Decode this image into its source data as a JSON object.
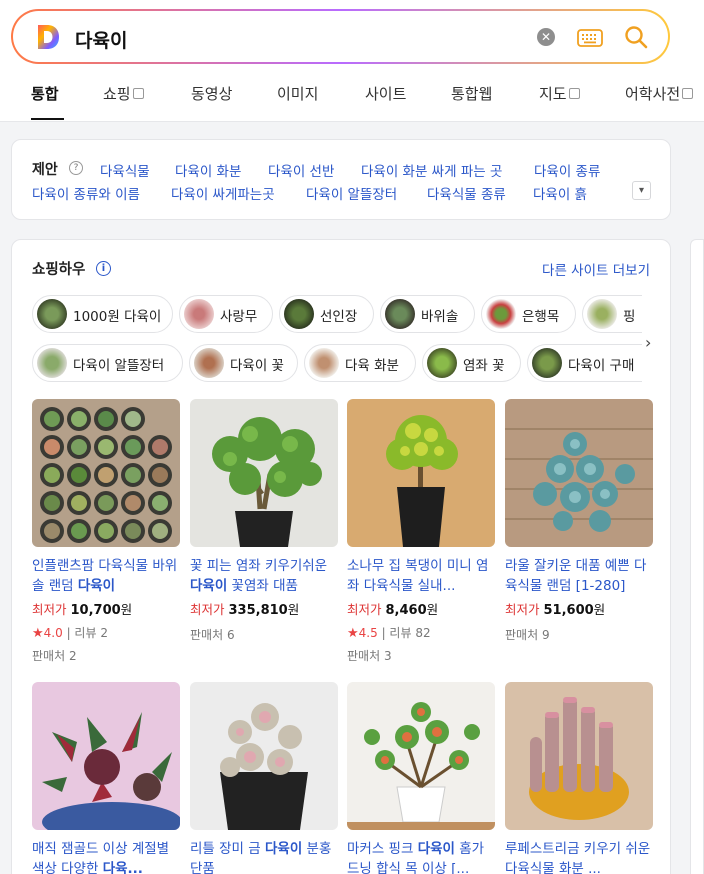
{
  "search": {
    "query": "다육이"
  },
  "tabs": [
    {
      "label": "통합"
    },
    {
      "label": "쇼핑"
    },
    {
      "label": "동영상"
    },
    {
      "label": "이미지"
    },
    {
      "label": "사이트"
    },
    {
      "label": "통합웹"
    },
    {
      "label": "지도"
    },
    {
      "label": "어학사전"
    }
  ],
  "suggest": {
    "label": "제안",
    "items": [
      "다육식물",
      "다육이 화분",
      "다육이 선반",
      "다육이 화분 싸게 파는 곳",
      "다육이 종류",
      "다육이 종류와 이름",
      "다육이 싸게파는곳",
      "다육이 알뜰장터",
      "다육식물 종류",
      "다육이 흙"
    ]
  },
  "shopping": {
    "title": "쇼핑하우",
    "more": "다른 사이트 더보기",
    "chips": [
      "1000원 다육이",
      "사랑무",
      "선인장",
      "바위솔",
      "은행목",
      "핑",
      "다육이 알뜰장터",
      "다육이 꽃",
      "다육 화분",
      "염좌 꽃",
      "다육이 구매"
    ],
    "price_prefix": "최저가",
    "currency": "원",
    "review_prefix": "리뷰",
    "seller_prefix": "판매처",
    "products": [
      {
        "title_pre": "인플랜츠팜 다육식물 바위솔 랜덤 ",
        "title_bold": "다육이",
        "title_post": "",
        "price": "10,700",
        "rating": "4.0",
        "reviews": "2",
        "sellers": "2"
      },
      {
        "title_pre": "꽃 피는 염좌 키우기쉬운 ",
        "title_bold": "다육이",
        "title_post": " 꽃염좌 대품",
        "price": "335,810",
        "rating": "",
        "reviews": "",
        "sellers": "6"
      },
      {
        "title_pre": "소나무 집 복댕이 미니 염좌 다육식물 실내...",
        "title_bold": "",
        "title_post": "",
        "price": "8,460",
        "rating": "4.5",
        "reviews": "82",
        "sellers": "3"
      },
      {
        "title_pre": "라울 잘키운 대품 예쁜 다육식물 랜덤 [1-280]",
        "title_bold": "",
        "title_post": "",
        "price": "51,600",
        "rating": "",
        "reviews": "",
        "sellers": "9"
      },
      {
        "title_pre": "매직 잼골드 이상 계절별 색상 다양한 ",
        "title_bold": "다육...",
        "title_post": "",
        "price": "",
        "rating": "",
        "reviews": "",
        "sellers": ""
      },
      {
        "title_pre": "리틀 장미 금 ",
        "title_bold": "다육이",
        "title_post": " 분홍 단품",
        "price": "",
        "rating": "",
        "reviews": "",
        "sellers": ""
      },
      {
        "title_pre": "마커스 핑크 ",
        "title_bold": "다육이",
        "title_post": " 홈가드닝 합식 목 이상 [...",
        "price": "",
        "rating": "",
        "reviews": "",
        "sellers": ""
      },
      {
        "title_pre": "루페스트리금 키우기 쉬운 다육식물 화분 ...",
        "title_bold": "",
        "title_post": "",
        "price": "",
        "rating": "",
        "reviews": "",
        "sellers": ""
      }
    ]
  }
}
